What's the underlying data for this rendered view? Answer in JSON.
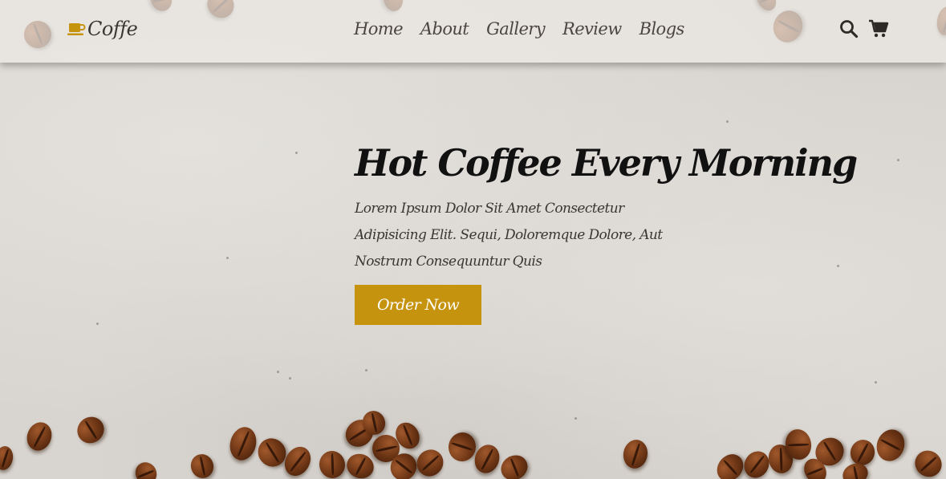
{
  "brand": {
    "name": "Coffe",
    "icon": "coffee-cup-icon",
    "accent": "#c6930f"
  },
  "nav": {
    "items": [
      {
        "label": "Home"
      },
      {
        "label": "About"
      },
      {
        "label": "Gallery"
      },
      {
        "label": "Review"
      },
      {
        "label": "Blogs"
      }
    ]
  },
  "header_icons": {
    "search": "search-icon",
    "cart": "cart-icon"
  },
  "hero": {
    "title": "Hot Coffee Every Morning",
    "description": "Lorem Ipsum Dolor Sit Amet Consectetur Adipisicing Elit. Sequi, Doloremque Dolore, Aut Nostrum Consequuntur Quis",
    "cta_label": "Order Now"
  },
  "colors": {
    "header_bg": "#ece9e5",
    "button": "#c6930f",
    "text_dark": "#111111"
  }
}
